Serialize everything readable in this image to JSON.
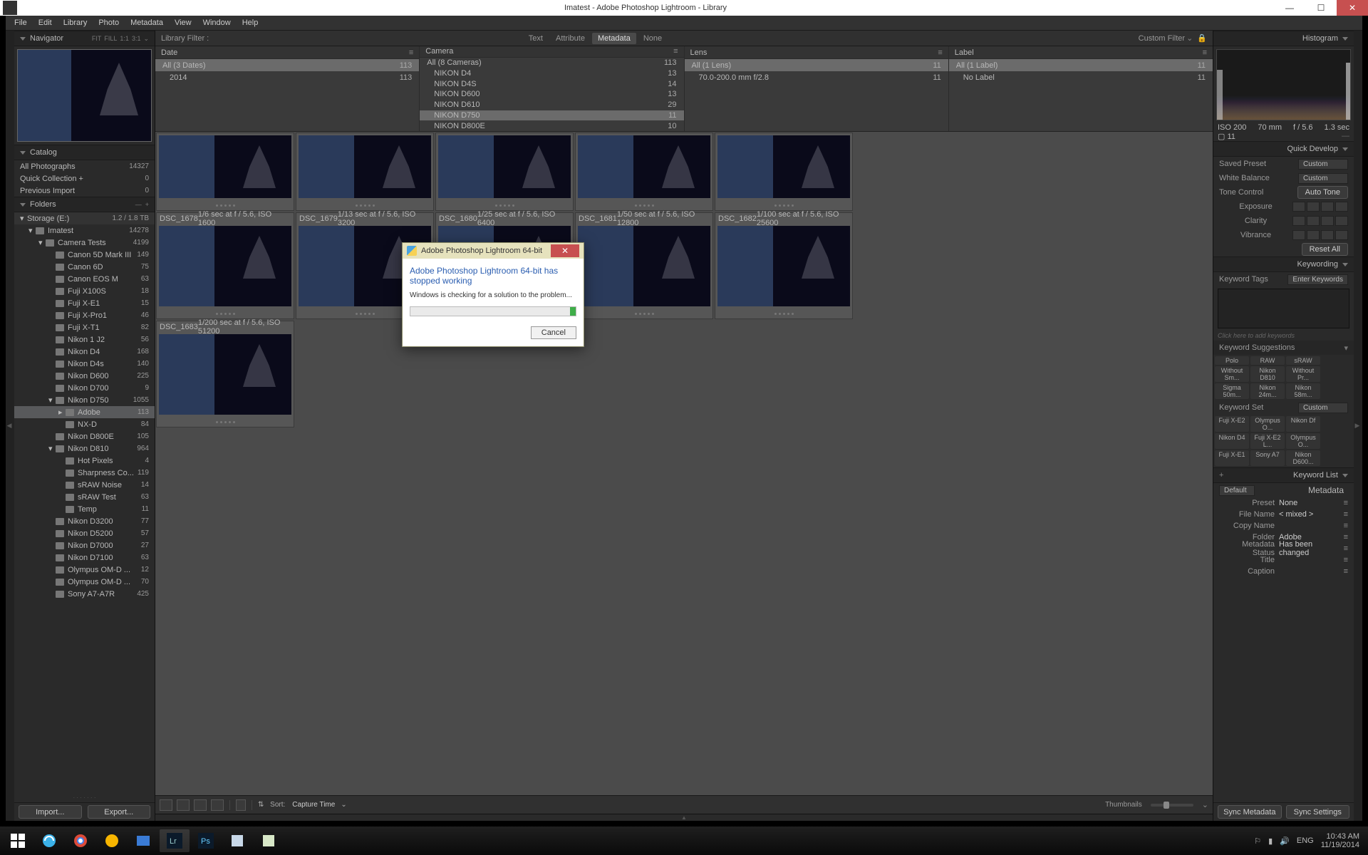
{
  "window": {
    "title": "Imatest - Adobe Photoshop Lightroom - Library"
  },
  "menubar": [
    "File",
    "Edit",
    "Library",
    "Photo",
    "Metadata",
    "View",
    "Window",
    "Help"
  ],
  "navigator": {
    "title": "Navigator",
    "modes": [
      "FIT",
      "FILL",
      "1:1",
      "3:1"
    ]
  },
  "catalog": {
    "title": "Catalog",
    "items": [
      {
        "label": "All Photographs",
        "count": "14327"
      },
      {
        "label": "Quick Collection  +",
        "count": "0"
      },
      {
        "label": "Previous Import",
        "count": "0"
      }
    ]
  },
  "folders": {
    "title": "Folders",
    "volume": {
      "label": "Storage (E:)",
      "cap": "1.2 / 1.8 TB"
    },
    "tree": [
      {
        "l": "Imatest",
        "c": "14278",
        "ind": 1,
        "tw": "▾"
      },
      {
        "l": "Camera Tests",
        "c": "4199",
        "ind": 2,
        "tw": "▾"
      },
      {
        "l": "Canon 5D Mark III",
        "c": "149",
        "ind": 3
      },
      {
        "l": "Canon 6D",
        "c": "75",
        "ind": 3
      },
      {
        "l": "Canon EOS M",
        "c": "63",
        "ind": 3
      },
      {
        "l": "Fuji X100S",
        "c": "18",
        "ind": 3
      },
      {
        "l": "Fuji X-E1",
        "c": "15",
        "ind": 3
      },
      {
        "l": "Fuji X-Pro1",
        "c": "46",
        "ind": 3
      },
      {
        "l": "Fuji X-T1",
        "c": "82",
        "ind": 3
      },
      {
        "l": "Nikon 1 J2",
        "c": "56",
        "ind": 3
      },
      {
        "l": "Nikon D4",
        "c": "168",
        "ind": 3
      },
      {
        "l": "Nikon D4s",
        "c": "140",
        "ind": 3
      },
      {
        "l": "Nikon D600",
        "c": "225",
        "ind": 3
      },
      {
        "l": "Nikon D700",
        "c": "9",
        "ind": 3
      },
      {
        "l": "Nikon D750",
        "c": "1055",
        "ind": 3,
        "tw": "▾"
      },
      {
        "l": "Adobe",
        "c": "113",
        "ind": 4,
        "sel": true,
        "tw": "▸"
      },
      {
        "l": "NX-D",
        "c": "84",
        "ind": 4
      },
      {
        "l": "Nikon D800E",
        "c": "105",
        "ind": 3
      },
      {
        "l": "Nikon D810",
        "c": "964",
        "ind": 3,
        "tw": "▾"
      },
      {
        "l": "Hot Pixels",
        "c": "4",
        "ind": 4
      },
      {
        "l": "Sharpness Co...",
        "c": "119",
        "ind": 4
      },
      {
        "l": "sRAW Noise",
        "c": "14",
        "ind": 4
      },
      {
        "l": "sRAW Test",
        "c": "63",
        "ind": 4
      },
      {
        "l": "Temp",
        "c": "11",
        "ind": 4
      },
      {
        "l": "Nikon D3200",
        "c": "77",
        "ind": 3
      },
      {
        "l": "Nikon D5200",
        "c": "57",
        "ind": 3
      },
      {
        "l": "Nikon D7000",
        "c": "27",
        "ind": 3
      },
      {
        "l": "Nikon D7100",
        "c": "63",
        "ind": 3
      },
      {
        "l": "Olympus OM-D ...",
        "c": "12",
        "ind": 3
      },
      {
        "l": "Olympus OM-D ...",
        "c": "70",
        "ind": 3
      },
      {
        "l": "Sony A7-A7R",
        "c": "425",
        "ind": 3
      }
    ]
  },
  "leftButtons": {
    "import": "Import...",
    "export": "Export..."
  },
  "libraryFilter": {
    "label": "Library Filter :",
    "tabs": [
      "Text",
      "Attribute",
      "Metadata",
      "None"
    ],
    "active": "Metadata",
    "preset": "Custom Filter"
  },
  "metaColumns": [
    {
      "head": "Date",
      "rows": [
        {
          "l": "All (3 Dates)",
          "c": "113",
          "sel": true
        },
        {
          "l": "2014",
          "c": "113",
          "sub": true
        }
      ]
    },
    {
      "head": "Camera",
      "rows": [
        {
          "l": "All (8 Cameras)",
          "c": "113"
        },
        {
          "l": "NIKON D4",
          "c": "13",
          "sub": true
        },
        {
          "l": "NIKON D4S",
          "c": "14",
          "sub": true
        },
        {
          "l": "NIKON D600",
          "c": "13",
          "sub": true
        },
        {
          "l": "NIKON D610",
          "c": "29",
          "sub": true
        },
        {
          "l": "NIKON D750",
          "c": "11",
          "sub": true,
          "sel": true
        },
        {
          "l": "NIKON D800E",
          "c": "10",
          "sub": true
        }
      ]
    },
    {
      "head": "Lens",
      "rows": [
        {
          "l": "All (1 Lens)",
          "c": "11",
          "sel": true
        },
        {
          "l": "70.0-200.0 mm f/2.8",
          "c": "11",
          "sub": true
        }
      ]
    },
    {
      "head": "Label",
      "rows": [
        {
          "l": "All (1 Label)",
          "c": "11",
          "sel": true
        },
        {
          "l": "No Label",
          "c": "11",
          "sub": true
        }
      ]
    }
  ],
  "thumbs": [
    {
      "name": "DSC_1678",
      "meta": "1/6 sec at f / 5.6, ISO 1600"
    },
    {
      "name": "DSC_1679",
      "meta": "1/13 sec at f / 5.6, ISO 3200"
    },
    {
      "name": "DSC_1680",
      "meta": "1/25 sec at f / 5.6, ISO 6400"
    },
    {
      "name": "DSC_1681",
      "meta": "1/50 sec at f / 5.6, ISO 12800"
    },
    {
      "name": "DSC_1682",
      "meta": "1/100 sec at f / 5.6, ISO 25600"
    },
    {
      "name": "DSC_1683",
      "meta": "1/200 sec at f / 5.6, ISO 51200"
    }
  ],
  "bottomToolbar": {
    "sortLabel": "Sort:",
    "sortValue": "Capture Time",
    "thumb": "Thumbnails"
  },
  "histogram": {
    "title": "Histogram",
    "labels": [
      "ISO 200",
      "70 mm",
      "f / 5.6",
      "1.3 sec"
    ],
    "sel": "11"
  },
  "quickDevelop": {
    "title": "Quick Develop",
    "savedPreset": {
      "lab": "Saved Preset",
      "val": "Custom"
    },
    "whiteBalance": {
      "lab": "White Balance",
      "val": "Custom"
    },
    "toneControl": {
      "lab": "Tone Control",
      "btn": "Auto Tone"
    },
    "sliders": [
      "Exposure",
      "Clarity",
      "Vibrance"
    ],
    "reset": "Reset All"
  },
  "keywording": {
    "title": "Keywording",
    "tags": {
      "lab": "Keyword Tags",
      "ph": "Enter Keywords"
    },
    "hint": "Click here to add keywords",
    "suggTitle": "Keyword Suggestions",
    "sugg": [
      "Polo",
      "RAW",
      "sRAW",
      "Without Sm...",
      "Nikon D810",
      "Without Pr...",
      "Sigma 50m...",
      "Nikon 24m...",
      "Nikon 58m..."
    ],
    "setLab": "Keyword Set",
    "setVal": "Custom",
    "set": [
      "Fuji X-E2",
      "Olympus O...",
      "Nikon Df",
      "Nikon D4",
      "Fuji X-E2 L...",
      "Olympus O...",
      "Fuji X-E1",
      "Sony A7",
      "Nikon D600..."
    ]
  },
  "keywordList": {
    "title": "Keyword List"
  },
  "metadataPanel": {
    "title": "Metadata",
    "presetLab": "Default",
    "rows": [
      {
        "l": "Preset",
        "v": "None"
      },
      {
        "l": "File Name",
        "v": "< mixed >"
      },
      {
        "l": "Copy Name",
        "v": ""
      },
      {
        "l": "Folder",
        "v": "Adobe"
      },
      {
        "l": "Metadata Status",
        "v": "Has been changed"
      },
      {
        "l": "Title",
        "v": ""
      },
      {
        "l": "Caption",
        "v": ""
      }
    ]
  },
  "syncButtons": {
    "meta": "Sync Metadata",
    "settings": "Sync Settings"
  },
  "errorDialog": {
    "title": "Adobe Photoshop Lightroom 64-bit",
    "heading": "Adobe Photoshop Lightroom 64-bit has stopped working",
    "body": "Windows is checking for a solution to the problem...",
    "cancel": "Cancel"
  },
  "tray": {
    "lang": "ENG",
    "time": "10:43 AM",
    "date": "11/19/2014"
  }
}
